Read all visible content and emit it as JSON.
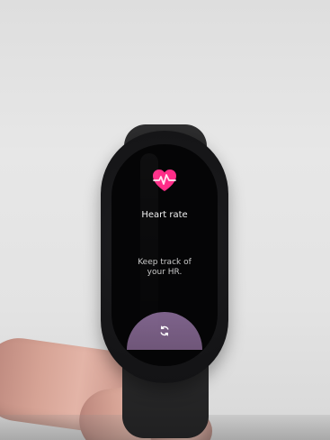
{
  "screen": {
    "title": "Heart rate",
    "subtitle_line1": "Keep track of",
    "subtitle_line2": "your HR."
  },
  "icons": {
    "heart": "heart-pulse-icon",
    "sync": "sync-icon"
  },
  "colors": {
    "heart": "#ff2d88",
    "screen_bg": "#050506",
    "button_bg": "#755a80",
    "text": "#f1f1f1"
  }
}
